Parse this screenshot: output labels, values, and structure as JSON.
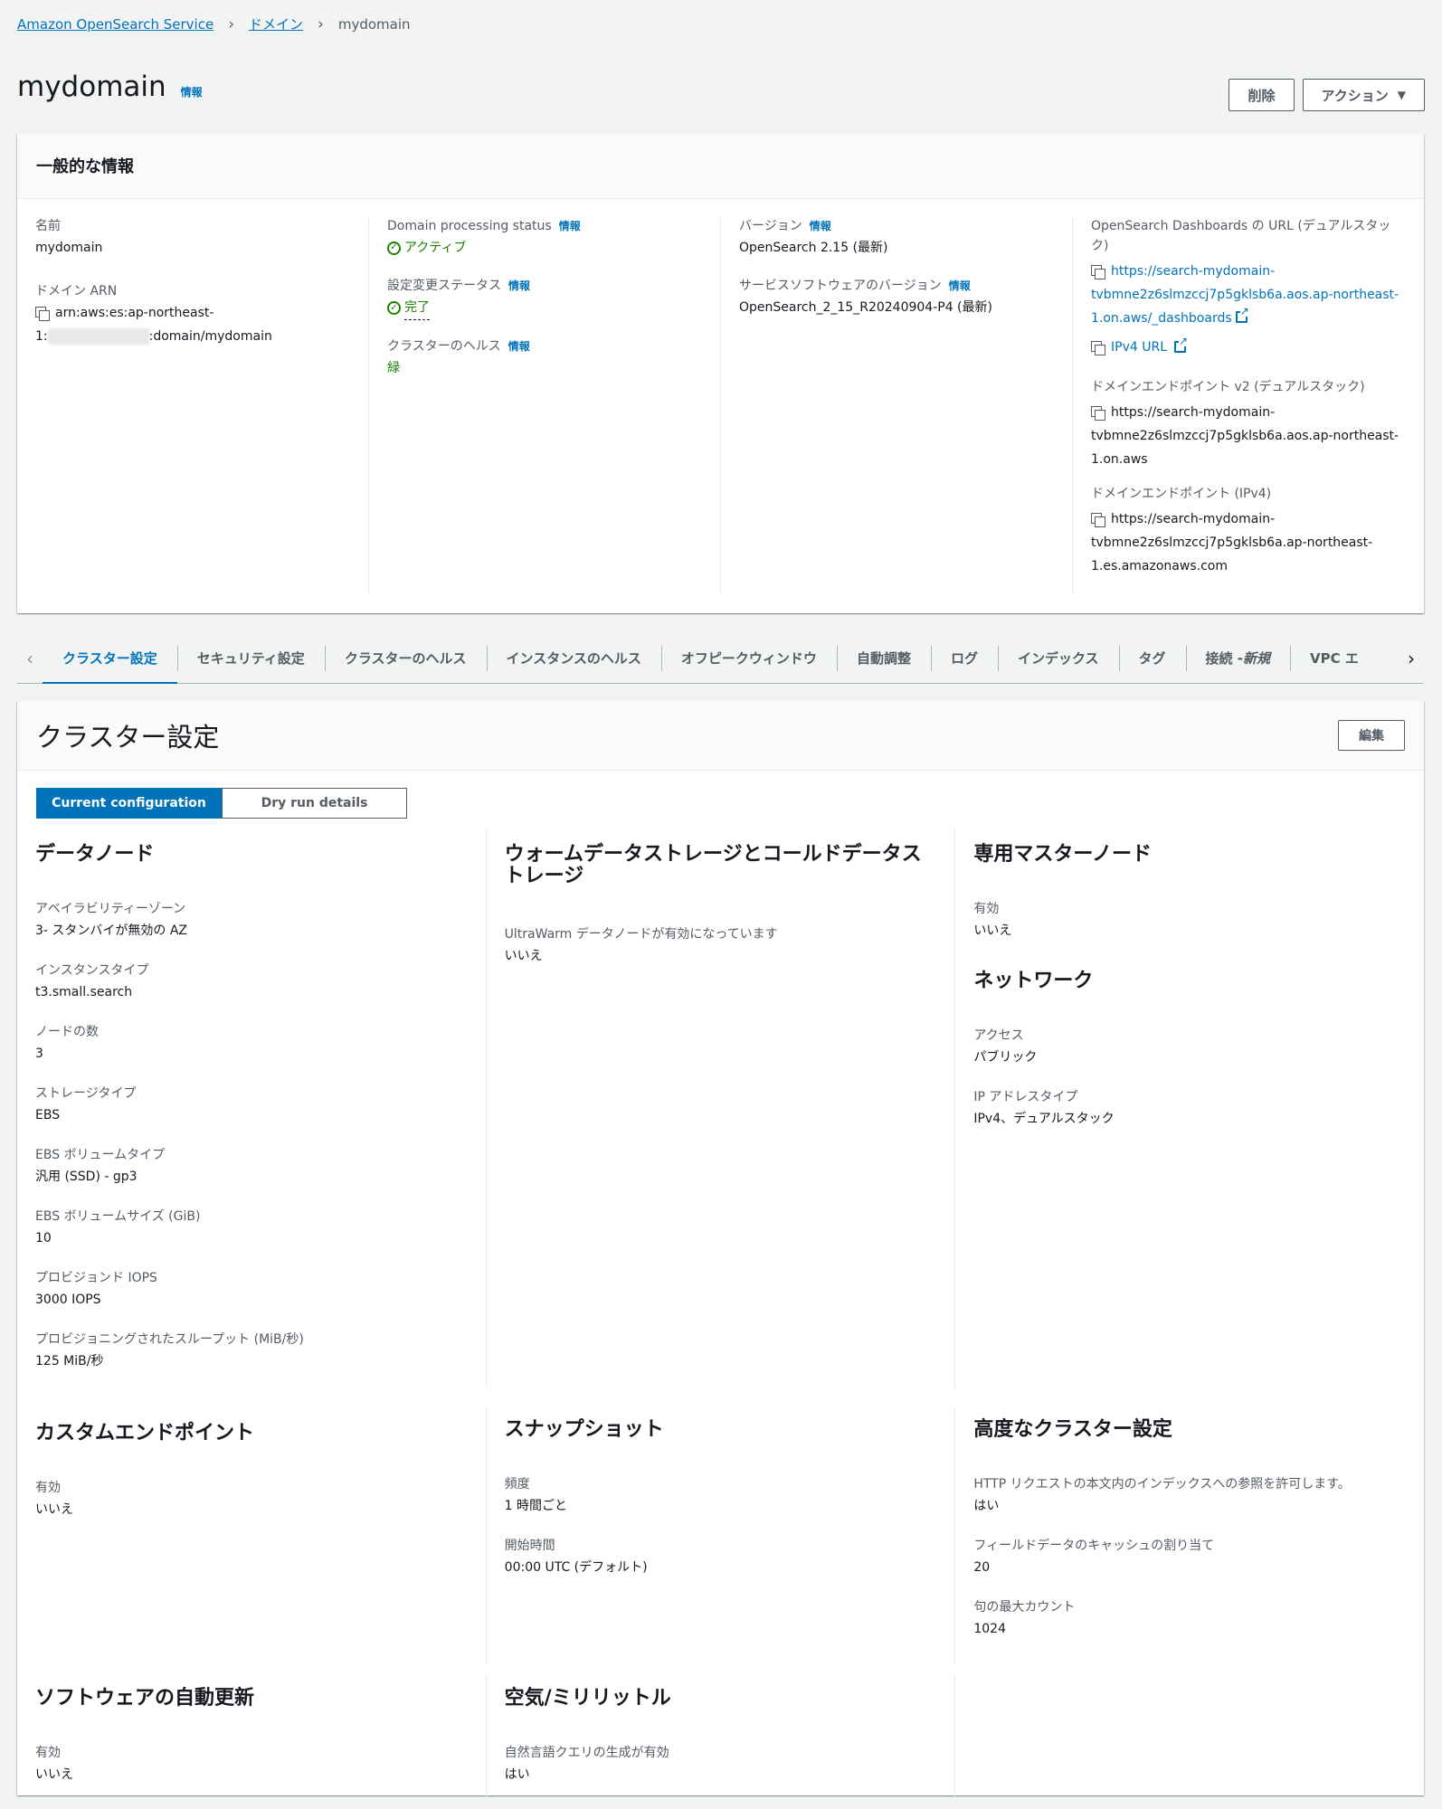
{
  "breadcrumb": {
    "service": "Amazon OpenSearch Service",
    "domains": "ドメイン",
    "current": "mydomain"
  },
  "header": {
    "title": "mydomain",
    "info": "情報",
    "delete_label": "削除",
    "actions_label": "アクション"
  },
  "general": {
    "title": "一般的な情報",
    "info": "情報",
    "name_label": "名前",
    "name_value": "mydomain",
    "arn_label": "ドメイン ARN",
    "arn_line1": "arn:aws:es:ap-northeast-",
    "arn_prefix2": "1:",
    "arn_suffix2": ":domain/mydomain",
    "processing_label": "Domain processing status",
    "processing_value": "アクティブ",
    "config_status_label": "設定変更ステータス",
    "config_status_value": "完了",
    "health_label": "クラスターのヘルス",
    "health_value": "緑",
    "version_label": "バージョン",
    "version_value": "OpenSearch 2.15 (最新)",
    "software_label": "サービスソフトウェアのバージョン",
    "software_value": "OpenSearch_2_15_R20240904-P4 (最新)",
    "dashboards_label": "OpenSearch Dashboards の URL (デュアルスタック)",
    "dashboards_url_1": "https://search-mydomain-",
    "dashboards_url_2": "tvbmne2z6slmzccj7p5gklsb6a.aos.ap-northeast-",
    "dashboards_url_3": "1.on.aws/_dashboards",
    "ipv4_url": "IPv4 URL",
    "endpoint_v2_label": "ドメインエンドポイント v2 (デュアルスタック)",
    "endpoint_v2_1": "https://search-mydomain-",
    "endpoint_v2_2": "tvbmne2z6slmzccj7p5gklsb6a.aos.ap-northeast-",
    "endpoint_v2_3": "1.on.aws",
    "endpoint_ipv4_label": "ドメインエンドポイント (IPv4)",
    "endpoint_ipv4_1": "https://search-mydomain-",
    "endpoint_ipv4_2": "tvbmne2z6slmzccj7p5gklsb6a.ap-northeast-",
    "endpoint_ipv4_3": "1.es.amazonaws.com"
  },
  "tabs": [
    {
      "label": "クラスター設定"
    },
    {
      "label": "セキュリティ設定"
    },
    {
      "label": "クラスターのヘルス"
    },
    {
      "label": "インスタンスのヘルス"
    },
    {
      "label": "オフピークウィンドウ"
    },
    {
      "label": "自動調整"
    },
    {
      "label": "ログ"
    },
    {
      "label": "インデックス"
    },
    {
      "label": "タグ"
    },
    {
      "label": "接続 - ",
      "label_new": "新規"
    },
    {
      "label": "VPC エ"
    }
  ],
  "cluster": {
    "title": "クラスター設定",
    "edit_label": "編集",
    "seg_current": "Current configuration",
    "seg_dryrun": "Dry run details",
    "data_nodes": {
      "title": "データノード",
      "az_label": "アベイラビリティーゾーン",
      "az_value": "3- スタンバイが無効の AZ",
      "instance_type_label": "インスタンスタイプ",
      "instance_type_value": "t3.small.search",
      "node_count_label": "ノードの数",
      "node_count_value": "3",
      "storage_type_label": "ストレージタイプ",
      "storage_type_value": "EBS",
      "ebs_type_label": "EBS ボリュームタイプ",
      "ebs_type_value": "汎用 (SSD) - gp3",
      "ebs_size_label": "EBS ボリュームサイズ (GiB)",
      "ebs_size_value": "10",
      "iops_label": "プロビジョンド IOPS",
      "iops_value": "3000 IOPS",
      "throughput_label": "プロビジョニングされたスループット (MiB/秒)",
      "throughput_value": "125 MiB/秒"
    },
    "warm": {
      "title": "ウォームデータストレージとコールドデータストレージ",
      "ultrawarm_label": "UltraWarm データノードが有効になっています",
      "ultrawarm_value": "いいえ"
    },
    "master": {
      "title": "専用マスターノード",
      "enabled_label": "有効",
      "enabled_value": "いいえ"
    },
    "network": {
      "title": "ネットワーク",
      "access_label": "アクセス",
      "access_value": "パブリック",
      "ip_type_label": "IP アドレスタイプ",
      "ip_type_value": "IPv4、デュアルスタック"
    },
    "custom_endpoint": {
      "title": "カスタムエンドポイント",
      "enabled_label": "有効",
      "enabled_value": "いいえ"
    },
    "snapshot": {
      "title": "スナップショット",
      "freq_label": "頻度",
      "freq_value": "1 時間ごと",
      "start_label": "開始時間",
      "start_value": "00:00 UTC (デフォルト)"
    },
    "advanced": {
      "title": "高度なクラスター設定",
      "http_label": "HTTP リクエストの本文内のインデックスへの参照を許可します。",
      "http_value": "はい",
      "fielddata_label": "フィールドデータのキャッシュの割り当て",
      "fielddata_value": "20",
      "clause_label": "句の最大カウント",
      "clause_value": "1024"
    },
    "auto_update": {
      "title": "ソフトウェアの自動更新",
      "enabled_label": "有効",
      "enabled_value": "いいえ"
    },
    "air": {
      "title": "空気/ミリリットル",
      "nlq_label": "自然言語クエリの生成が有効",
      "nlq_value": "はい"
    }
  }
}
